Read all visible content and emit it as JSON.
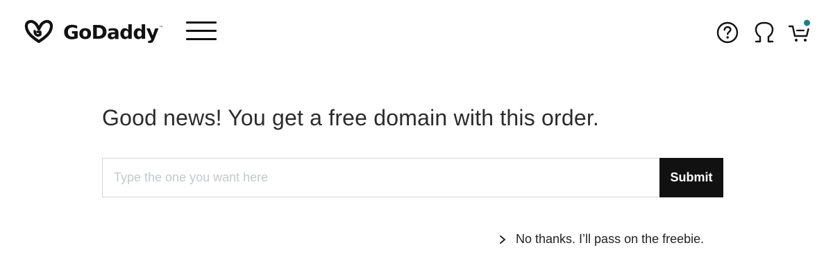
{
  "header": {
    "brand": "GoDaddy",
    "trademark": "™",
    "icons": {
      "logo": "godaddy-logo-icon",
      "menu": "hamburger-menu-icon",
      "help": "help-icon",
      "account": "account-icon",
      "cart": "cart-icon"
    },
    "cart_badge_color": "#1a7f8a"
  },
  "promo": {
    "heading": "Good news! You get a free domain with this order.",
    "input_placeholder": "Type the one you want here",
    "input_value": "",
    "submit_label": "Submit",
    "decline_label": "No thanks. I’ll pass on the freebie."
  },
  "colors": {
    "text": "#111111",
    "button_bg": "#111111",
    "button_text": "#ffffff",
    "placeholder": "#c4c9cc",
    "border": "#d6d6d6"
  }
}
